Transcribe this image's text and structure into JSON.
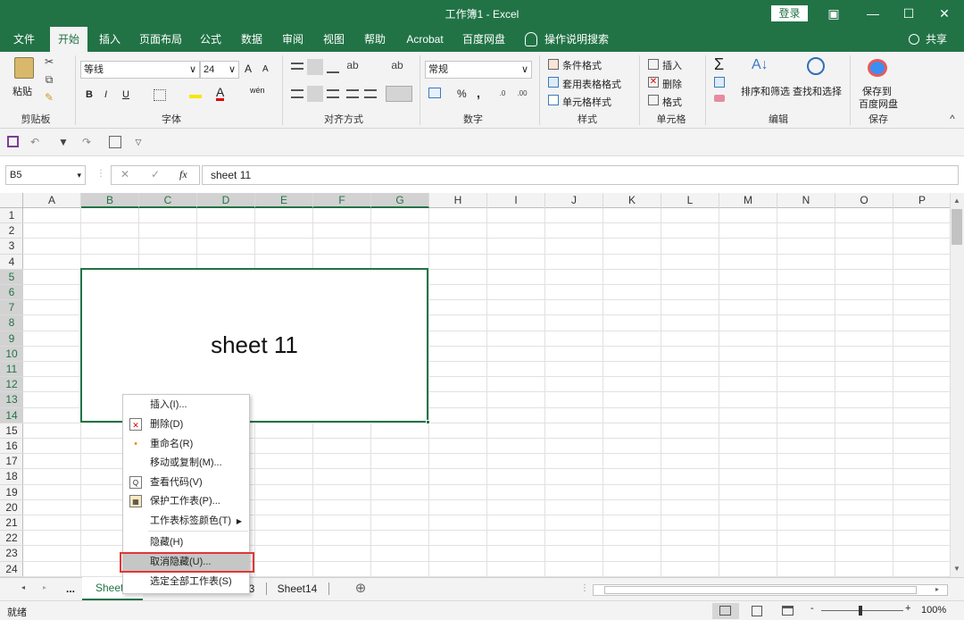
{
  "window": {
    "title": "工作簿1  -  Excel",
    "login": "登录",
    "ribbon_icon": "▣",
    "min": "—",
    "max": "☐",
    "close": "✕"
  },
  "menu": {
    "tabs": [
      "文件",
      "开始",
      "插入",
      "页面布局",
      "公式",
      "数据",
      "审阅",
      "视图",
      "帮助",
      "Acrobat",
      "百度网盘"
    ],
    "search": "操作说明搜索",
    "share": "共享"
  },
  "ribbon": {
    "clipboard": {
      "paste": "粘贴",
      "label": "剪贴板"
    },
    "font": {
      "name": "等线",
      "size": "24",
      "bold": "B",
      "italic": "I",
      "underline": "U",
      "label": "字体",
      "grow": "A",
      "shrink": "A",
      "wen": "wén"
    },
    "align": {
      "label": "对齐方式"
    },
    "number": {
      "format": "常规",
      "label": "数字",
      "percent": "%",
      "comma": ","
    },
    "styles": {
      "cond": "条件格式",
      "table": "套用表格格式",
      "cell": "单元格样式",
      "label": "样式"
    },
    "cells": {
      "insert": "插入",
      "delete": "删除",
      "format": "格式",
      "label": "单元格"
    },
    "edit": {
      "sort": "排序和筛选",
      "find": "查找和选择",
      "label": "编辑"
    },
    "save": {
      "line1": "保存到",
      "line2": "百度网盘",
      "label": "保存"
    }
  },
  "formula_bar": {
    "namebox": "B5",
    "fx": "fx",
    "cancel": "✕",
    "enter": "✓",
    "content": "sheet 11"
  },
  "grid": {
    "columns": [
      "A",
      "B",
      "C",
      "D",
      "E",
      "F",
      "G",
      "H",
      "I",
      "J",
      "K",
      "L",
      "M",
      "N",
      "O",
      "P"
    ],
    "rows": [
      "1",
      "2",
      "3",
      "4",
      "5",
      "6",
      "7",
      "8",
      "9",
      "10",
      "11",
      "12",
      "13",
      "14",
      "15",
      "16",
      "17",
      "18",
      "19",
      "20",
      "21",
      "22",
      "23",
      "24"
    ],
    "merged_text": "sheet 11"
  },
  "sheets": {
    "tabs": [
      "Sheet1",
      "3",
      "Sheet14"
    ],
    "more": "...",
    "add": "⊕"
  },
  "context_menu": {
    "items": [
      "插入(I)...",
      "删除(D)",
      "重命名(R)",
      "移动或复制(M)...",
      "查看代码(V)",
      "保护工作表(P)...",
      "工作表标签颜色(T)",
      "隐藏(H)",
      "取消隐藏(U)...",
      "选定全部工作表(S)"
    ]
  },
  "status": {
    "mode": "就绪",
    "zoom": "100%",
    "minus": "-",
    "plus": "+"
  },
  "colors": {
    "excel_green": "#217346",
    "highlight_red": "#e03636"
  }
}
